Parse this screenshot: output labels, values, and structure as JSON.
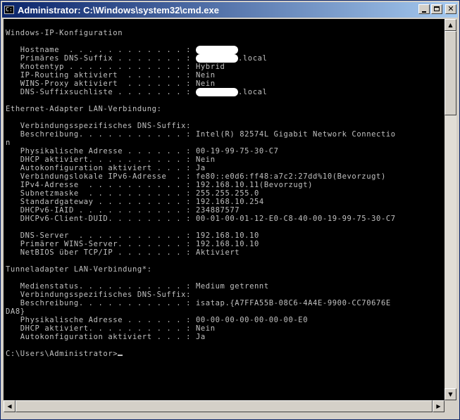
{
  "window": {
    "title": "Administrator: C:\\Windows\\system32\\cmd.exe",
    "icon": "cmd-icon"
  },
  "console": {
    "lines_a": [
      "Windows-IP-Konfiguration",
      "",
      "   Hostname  . . . . . . . . . . . . : "
    ],
    "dns_suffix_line": "   Primäres DNS-Suffix . . . . . . . : ",
    "dns_suffix_tail": ".local",
    "lines_b": [
      "   Knotentyp . . . . . . . . . . . . : Hybrid",
      "   IP-Routing aktiviert  . . . . . . : Nein",
      "   WINS-Proxy aktiviert  . . . . . . : Nein"
    ],
    "dns_list_line": "   DNS-Suffixsuchliste . . . . . . . : ",
    "dns_list_tail": ".local",
    "lines_c": [
      "",
      "Ethernet-Adapter LAN-Verbindung:",
      "",
      "   Verbindungsspezifisches DNS-Suffix:",
      "   Beschreibung. . . . . . . . . . . : Intel(R) 82574L Gigabit Network Connectio",
      "n",
      "   Physikalische Adresse . . . . . . : 00-19-99-75-30-C7",
      "   DHCP aktiviert. . . . . . . . . . : Nein",
      "   Autokonfiguration aktiviert . . . : Ja",
      "   Verbindungslokale IPv6-Adresse  . : fe80::e0d6:ff48:a7c2:27dd%10(Bevorzugt)",
      "   IPv4-Adresse  . . . . . . . . . . : 192.168.10.11(Bevorzugt)",
      "   Subnetzmaske  . . . . . . . . . . : 255.255.255.0",
      "   Standardgateway . . . . . . . . . : 192.168.10.254",
      "   DHCPv6-IAID . . . . . . . . . . . : 234887577",
      "   DHCPv6-Client-DUID. . . . . . . . : 00-01-00-01-12-E0-C8-40-00-19-99-75-30-C7",
      "",
      "   DNS-Server  . . . . . . . . . . . : 192.168.10.10",
      "   Primärer WINS-Server. . . . . . . : 192.168.10.10",
      "   NetBIOS über TCP/IP . . . . . . . : Aktiviert",
      "",
      "Tunneladapter LAN-Verbindung*:",
      "",
      "   Medienstatus. . . . . . . . . . . : Medium getrennt",
      "   Verbindungsspezifisches DNS-Suffix:",
      "   Beschreibung. . . . . . . . . . . : isatap.{A7FFA55B-08C6-4A4E-9900-CC70676E",
      "DA8}",
      "   Physikalische Adresse . . . . . . : 00-00-00-00-00-00-00-E0",
      "   DHCP aktiviert. . . . . . . . . . : Nein",
      "   Autokonfiguration aktiviert . . . : Ja",
      ""
    ],
    "prompt": "C:\\Users\\Administrator>"
  }
}
